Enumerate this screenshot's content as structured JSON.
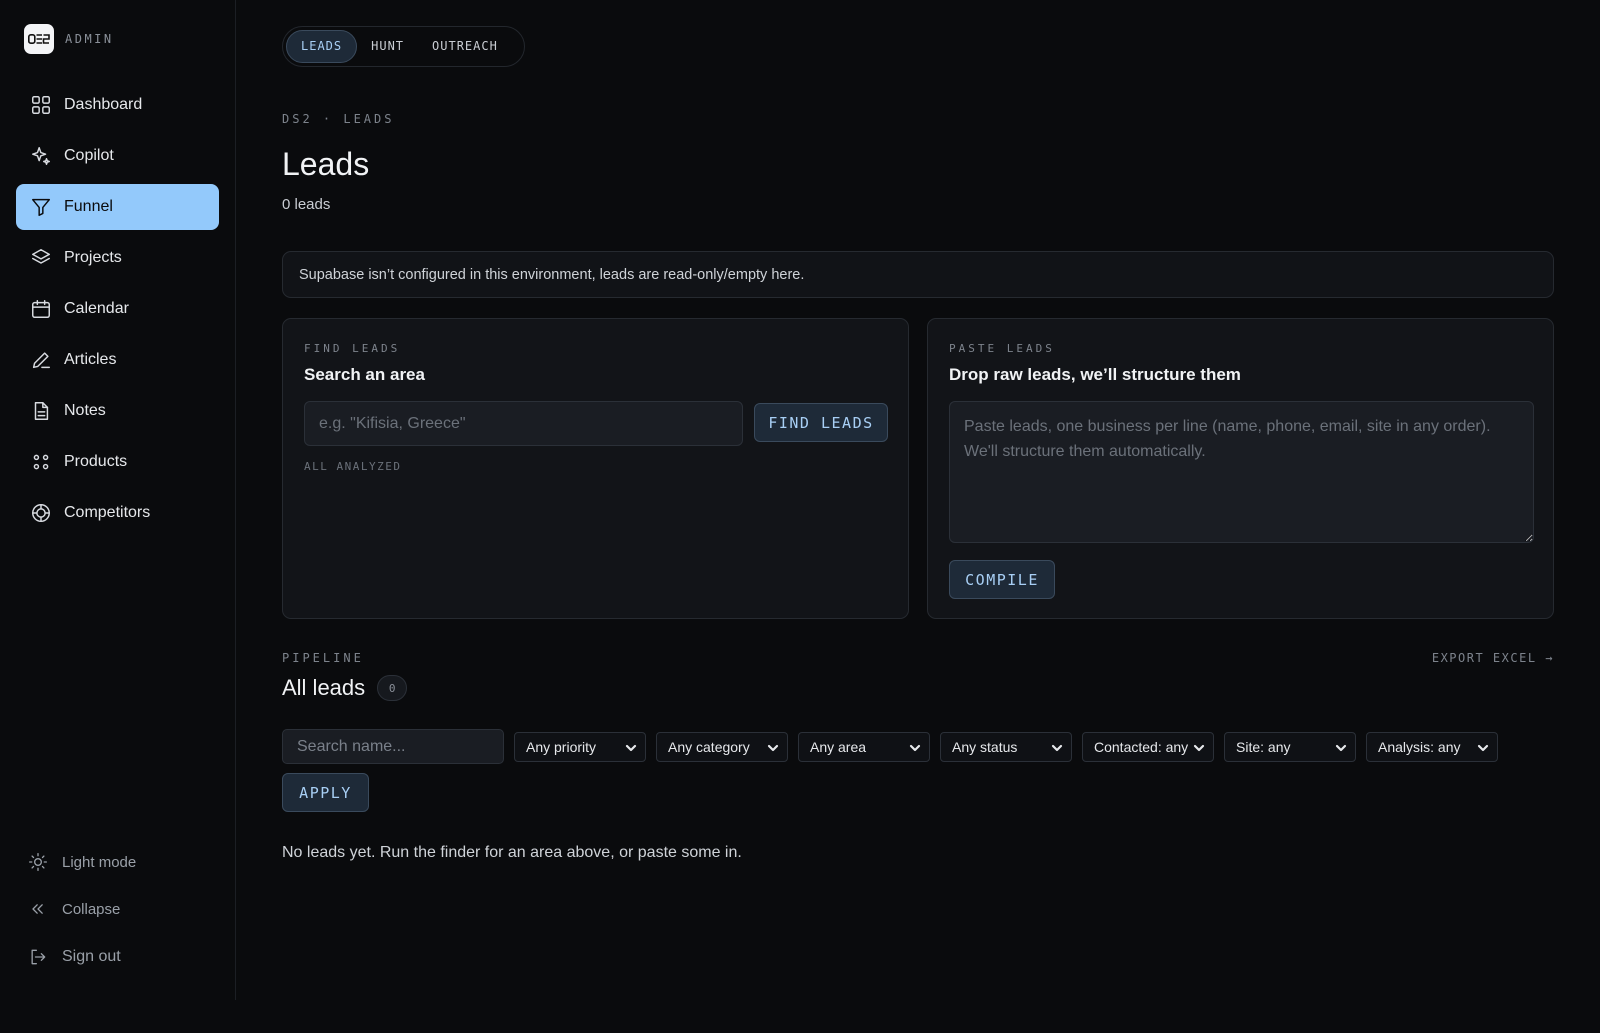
{
  "brand": {
    "logo_text": "DS2",
    "label": "ADMIN"
  },
  "nav": {
    "items": [
      {
        "label": "Dashboard",
        "icon": "grid-icon"
      },
      {
        "label": "Copilot",
        "icon": "sparkle-icon"
      },
      {
        "label": "Funnel",
        "icon": "funnel-icon",
        "active": true
      },
      {
        "label": "Projects",
        "icon": "layers-icon"
      },
      {
        "label": "Calendar",
        "icon": "calendar-icon"
      },
      {
        "label": "Articles",
        "icon": "pen-icon"
      },
      {
        "label": "Notes",
        "icon": "document-icon"
      },
      {
        "label": "Products",
        "icon": "dots-icon"
      },
      {
        "label": "Competitors",
        "icon": "target-icon"
      }
    ]
  },
  "sidebar_bottom": {
    "light_mode": "Light mode",
    "collapse": "Collapse",
    "sign_out": "Sign out"
  },
  "tabs": [
    {
      "label": "LEADS",
      "active": true
    },
    {
      "label": "HUNT"
    },
    {
      "label": "OUTREACH"
    }
  ],
  "header": {
    "breadcrumb": "DS2 · LEADS",
    "title": "Leads",
    "subtitle": "0 leads"
  },
  "notice": "Supabase isn’t configured in this environment, leads are read-only/empty here.",
  "find_card": {
    "kicker": "FIND LEADS",
    "title": "Search an area",
    "input_placeholder": "e.g. \"Kifisia, Greece\"",
    "input_value": "",
    "button": "FIND LEADS",
    "status": "ALL ANALYZED"
  },
  "paste_card": {
    "kicker": "PASTE LEADS",
    "title": "Drop raw leads, we’ll structure them",
    "textarea_placeholder": "Paste leads, one business per line (name, phone, email, site in any order). We'll structure them automatically.",
    "button": "COMPILE"
  },
  "pipeline": {
    "kicker": "PIPELINE",
    "export": "EXPORT EXCEL →",
    "title": "All leads",
    "count": "0",
    "search_placeholder": "Search name...",
    "filters": {
      "priority": "Any priority",
      "category": "Any category",
      "area": "Any area",
      "status": "Any status",
      "contacted": "Contacted: any",
      "site": "Site: any",
      "analysis": "Analysis: any"
    },
    "apply": "APPLY",
    "empty": "No leads yet. Run the finder for an area above, or paste some in."
  },
  "colors": {
    "background": "#0a0b0d",
    "accent": "#93c9fb",
    "button_bg": "#1e2a38",
    "button_text": "#a8cff5"
  }
}
